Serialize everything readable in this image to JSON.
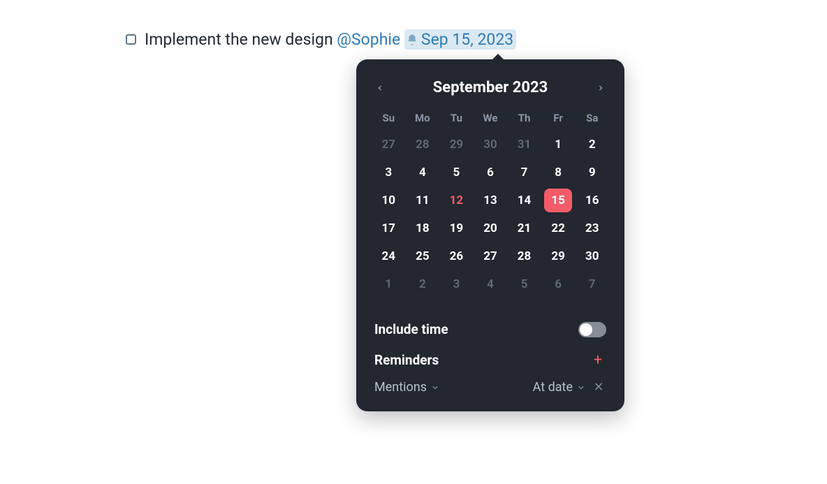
{
  "task": {
    "text": "Implement the new design ",
    "mention": "@Sophie",
    "date_label": "Sep 15, 2023"
  },
  "calendar": {
    "title": "September 2023",
    "dow": [
      "Su",
      "Mo",
      "Tu",
      "We",
      "Th",
      "Fr",
      "Sa"
    ],
    "days": [
      {
        "n": "27",
        "out": true
      },
      {
        "n": "28",
        "out": true
      },
      {
        "n": "29",
        "out": true
      },
      {
        "n": "30",
        "out": true
      },
      {
        "n": "31",
        "out": true
      },
      {
        "n": "1"
      },
      {
        "n": "2"
      },
      {
        "n": "3"
      },
      {
        "n": "4"
      },
      {
        "n": "5"
      },
      {
        "n": "6"
      },
      {
        "n": "7"
      },
      {
        "n": "8"
      },
      {
        "n": "9"
      },
      {
        "n": "10"
      },
      {
        "n": "11"
      },
      {
        "n": "12",
        "today": true
      },
      {
        "n": "13"
      },
      {
        "n": "14"
      },
      {
        "n": "15",
        "selected": true
      },
      {
        "n": "16"
      },
      {
        "n": "17"
      },
      {
        "n": "18"
      },
      {
        "n": "19"
      },
      {
        "n": "20"
      },
      {
        "n": "21"
      },
      {
        "n": "22"
      },
      {
        "n": "23"
      },
      {
        "n": "24"
      },
      {
        "n": "25"
      },
      {
        "n": "26"
      },
      {
        "n": "27"
      },
      {
        "n": "28"
      },
      {
        "n": "29"
      },
      {
        "n": "30"
      },
      {
        "n": "1",
        "out": true
      },
      {
        "n": "2",
        "out": true
      },
      {
        "n": "3",
        "out": true
      },
      {
        "n": "4",
        "out": true
      },
      {
        "n": "5",
        "out": true
      },
      {
        "n": "6",
        "out": true
      },
      {
        "n": "7",
        "out": true
      }
    ]
  },
  "include_time": {
    "label": "Include time",
    "on": false
  },
  "reminders": {
    "label": "Reminders",
    "items": [
      {
        "type": "Mentions",
        "when": "At date"
      }
    ]
  }
}
